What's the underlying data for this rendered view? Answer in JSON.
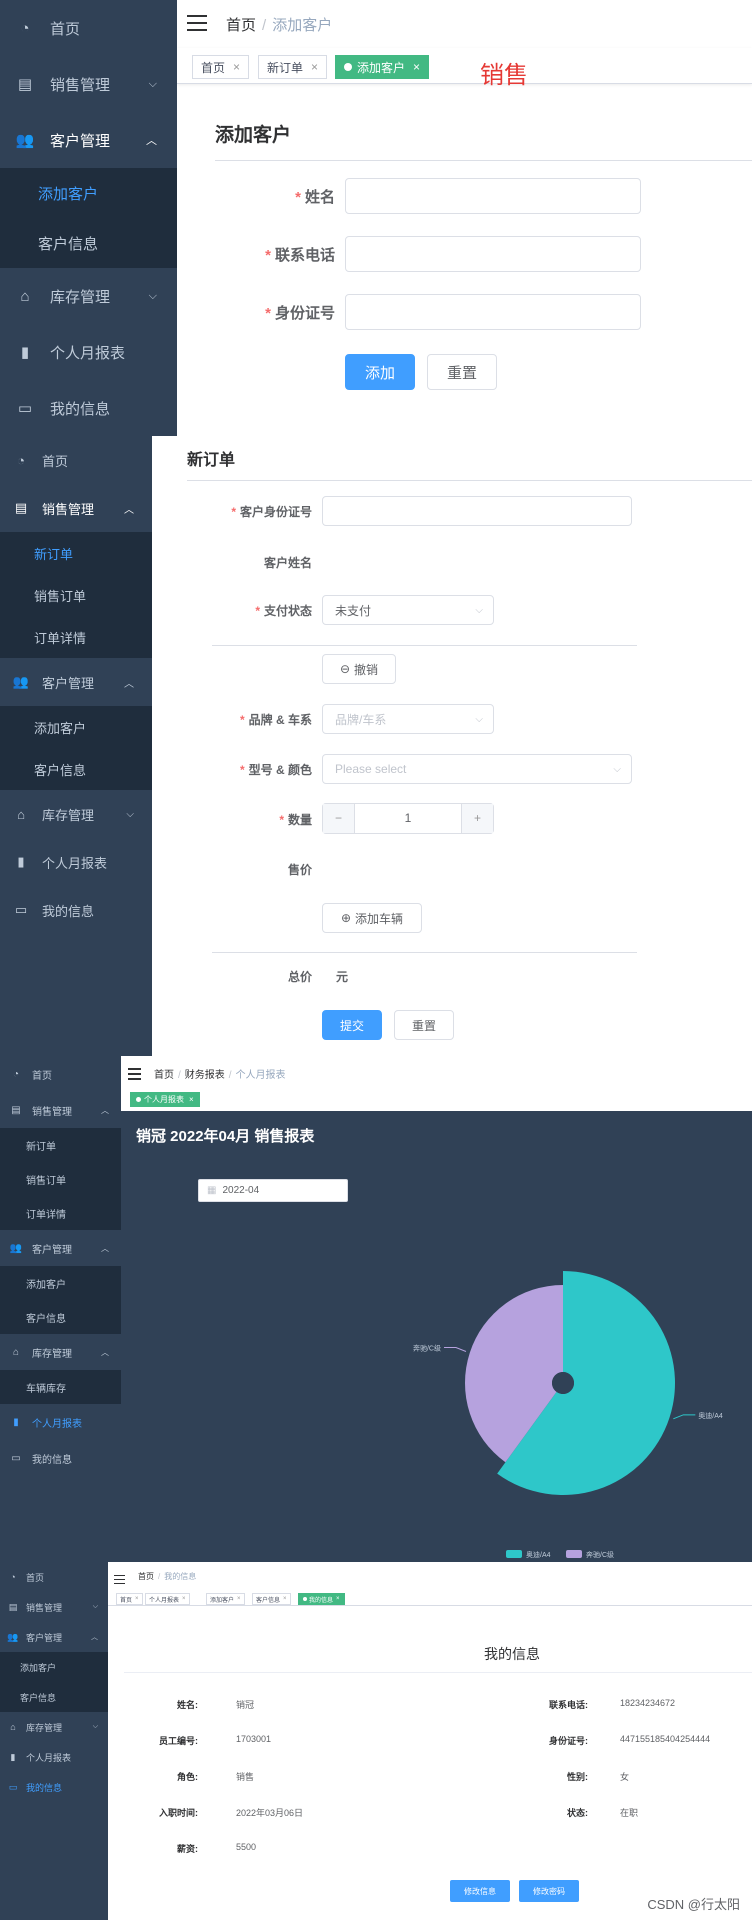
{
  "icons": {
    "dashboard": "dashboard-icon",
    "sales": "document-icon",
    "customer": "users-icon",
    "inventory": "house-icon",
    "report": "bar-chart-icon",
    "info": "id-card-icon",
    "menu": "hamburger-icon",
    "chevron": "chevron-icon",
    "close": "close-icon"
  },
  "colors": {
    "sidebar_bg": "#304156",
    "sidebar_sub_bg": "#1f2d3d",
    "sidebar_text": "#bfcbd9",
    "active": "#409eff",
    "tag_active": "#42b983",
    "required": "#f56c6c",
    "chart_bg": "#304156",
    "pie_teal": "#2ec7c9",
    "pie_purple": "#b6a2de",
    "annotation": "#e53935"
  },
  "panel1": {
    "sidebar": {
      "home": "首页",
      "sales": "销售管理",
      "customer": "客户管理",
      "add_customer": "添加客户",
      "customer_info": "客户信息",
      "inventory": "库存管理",
      "monthly_report": "个人月报表",
      "my_info": "我的信息"
    },
    "breadcrumb": {
      "home": "首页",
      "sep": "/",
      "current": "添加客户"
    },
    "tags": {
      "home": "首页",
      "new_order": "新订单",
      "add_customer": "添加客户",
      "close": "×"
    },
    "annotation": "销售",
    "form": {
      "title": "添加客户",
      "req": "*",
      "name_label": "姓名",
      "phone_label": "联系电话",
      "id_label": "身份证号",
      "add_btn": "添加",
      "reset_btn": "重置"
    }
  },
  "panel2": {
    "sidebar": {
      "home": "首页",
      "sales": "销售管理",
      "new_order": "新订单",
      "sales_order": "销售订单",
      "order_detail": "订单详情",
      "customer": "客户管理",
      "add_customer": "添加客户",
      "customer_info": "客户信息",
      "inventory": "库存管理",
      "monthly_report": "个人月报表",
      "my_info": "我的信息"
    },
    "form": {
      "title": "新订单",
      "req": "*",
      "id_label": "客户身份证号",
      "name_label": "客户姓名",
      "pay_label": "支付状态",
      "pay_value": "未支付",
      "cancel_btn": "撤销",
      "brand_label": "品牌 & 车系",
      "brand_ph": "品牌/车系",
      "model_label": "型号 & 颜色",
      "model_ph": "Please select",
      "qty_label": "数量",
      "qty_minus": "−",
      "qty_value": "1",
      "qty_plus": "+",
      "price_label": "售价",
      "add_car_btn": "添加车辆",
      "total_label": "总价",
      "total_unit": "元",
      "submit_btn": "提交",
      "reset_btn": "重置"
    }
  },
  "panel3": {
    "sidebar": {
      "home": "首页",
      "sales": "销售管理",
      "new_order": "新订单",
      "sales_order": "销售订单",
      "order_detail": "订单详情",
      "customer": "客户管理",
      "add_customer": "添加客户",
      "customer_info": "客户信息",
      "inventory": "库存管理",
      "car_stock": "车辆库存",
      "monthly_report": "个人月报表",
      "my_info": "我的信息"
    },
    "breadcrumb": {
      "home": "首页",
      "sep": "/",
      "mid": "财务报表",
      "current": "个人月报表"
    },
    "tags": {
      "report": "个人月报表",
      "close": "×"
    },
    "report_title": "销冠 2022年04月 销售报表",
    "date_value": "2022-04"
  },
  "chart_data": {
    "type": "pie",
    "title": "",
    "categories": [
      "奥迪/A4",
      "奔驰/C级"
    ],
    "values": [
      60,
      40
    ],
    "legend": "bottom-right",
    "colors": [
      "#2ec7c9",
      "#b6a2de"
    ]
  },
  "panel4": {
    "sidebar": {
      "home": "首页",
      "sales": "销售管理",
      "customer": "客户管理",
      "add_customer": "添加客户",
      "customer_info": "客户信息",
      "inventory": "库存管理",
      "monthly_report": "个人月报表",
      "my_info": "我的信息"
    },
    "breadcrumb": {
      "home": "首页",
      "sep": "/",
      "current": "我的信息"
    },
    "tags": {
      "home": "首页",
      "report": "个人月报表",
      "add_customer": "添加客户",
      "customer_info": "客户信息",
      "my_info": "我的信息",
      "close": "×"
    },
    "title": "我的信息",
    "fields": {
      "name_label": "姓名:",
      "name_value": "销冠",
      "phone_label": "联系电话:",
      "phone_value": "18234234672",
      "emp_label": "员工编号:",
      "emp_value": "1703001",
      "id_label": "身份证号:",
      "id_value": "447155185404254444",
      "role_label": "角色:",
      "role_value": "销售",
      "gender_label": "性别:",
      "gender_value": "女",
      "join_label": "入职时间:",
      "join_value": "2022年03月06日",
      "status_label": "状态:",
      "status_value": "在职",
      "salary_label": "薪资:",
      "salary_value": "5500"
    },
    "edit_btn": "修改信息",
    "pwd_btn": "修改密码"
  },
  "watermark": "CSDN @行太阳"
}
